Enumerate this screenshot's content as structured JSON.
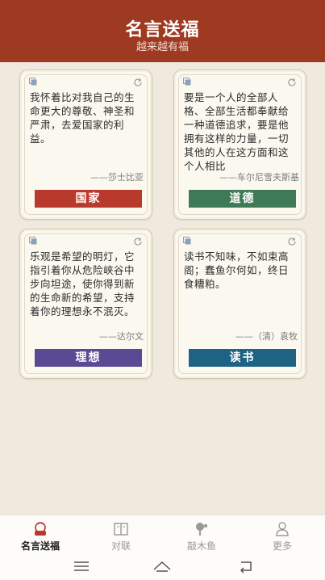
{
  "header": {
    "title": "名言送福",
    "subtitle": "越来越有福"
  },
  "cards": [
    {
      "quote": "我怀着比对我自己的生命更大的尊敬、神圣和严肃，去爱国家的利益。",
      "author": "——莎士比亚",
      "tag": "国家",
      "tag_color": "#b83a2c"
    },
    {
      "quote": "要是一个人的全部人格、全部生活都奉献给一种道德追求，要是他拥有这样的力量，一切其他的人在这方面和这个人相比",
      "author": "——车尔尼雪夫斯基",
      "tag": "道德",
      "tag_color": "#3e7a55"
    },
    {
      "quote": "乐观是希望的明灯，它指引着你从危险峡谷中步向坦途，使你得到新的生命新的希望，支持着你的理想永不泯灭。",
      "author": "——达尔文",
      "tag": "理想",
      "tag_color": "#5a4a94"
    },
    {
      "quote": "读书不知味，不如束高阁；蠢鱼尔何如，终日食糟粕。",
      "author": "——（清）袁牧",
      "tag": "读书",
      "tag_color": "#1f6384"
    }
  ],
  "tabbar": {
    "tabs": [
      {
        "label": "名言送福",
        "icon": "gift-icon",
        "active": true
      },
      {
        "label": "对联",
        "icon": "couplet-icon",
        "active": false
      },
      {
        "label": "敲木鱼",
        "icon": "wooden-fish-icon",
        "active": false
      },
      {
        "label": "更多",
        "icon": "person-icon",
        "active": false
      }
    ]
  },
  "colors": {
    "header_bg": "#9f3a22",
    "page_bg": "#efe9de",
    "card_bg": "#fbf8ef"
  }
}
